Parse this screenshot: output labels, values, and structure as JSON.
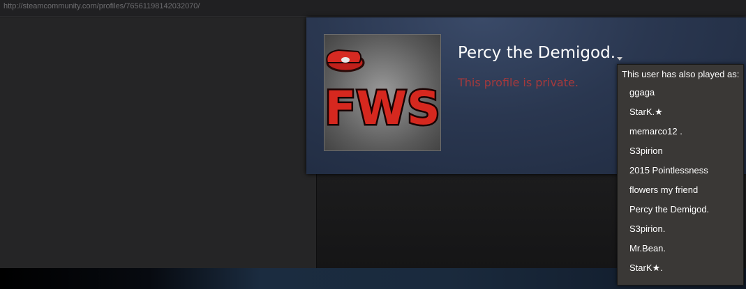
{
  "browser": {
    "url": "http://steamcommunity.com/profiles/76561198142032070/"
  },
  "profile": {
    "name": "Percy the Demigod.",
    "status": "This profile is private.",
    "avatar_text": "FWS",
    "dropdown_icon": "triangle-down-icon"
  },
  "aliases": {
    "header": "This user has also played as:",
    "items": [
      "ggaga",
      "StarK.★",
      "memarco12 .",
      "S3pirion",
      "2015 Pointlessness",
      "flowers my friend",
      "Percy the Demigod.",
      "S3pirion.",
      "Mr.Bean.",
      "StarK★."
    ]
  },
  "colors": {
    "private_text": "#a5393c",
    "header_bg": "#2a3750",
    "popup_bg": "#3a3836"
  }
}
